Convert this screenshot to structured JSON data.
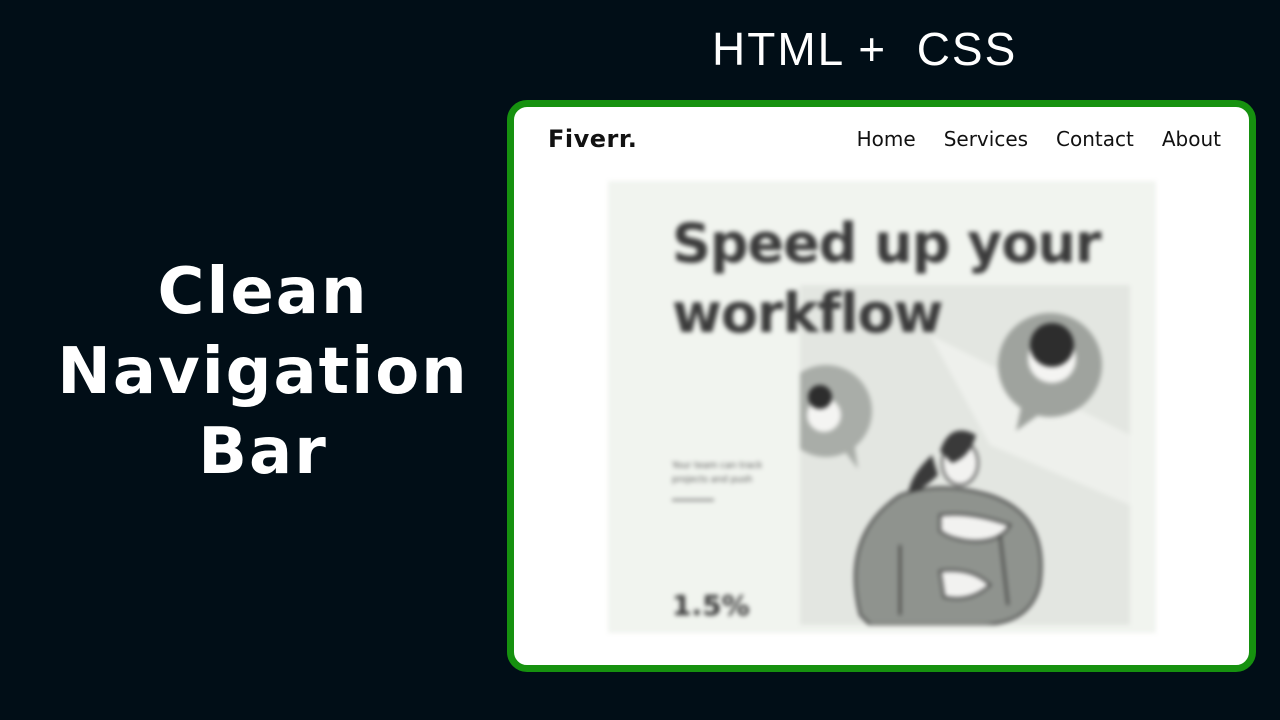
{
  "header": {
    "tech_label": "HTML +  CSS"
  },
  "title": {
    "lines": [
      "Clean",
      "Navigation",
      "Bar"
    ]
  },
  "preview": {
    "border_color": "#16910f",
    "navbar": {
      "logo": "Fiverr.",
      "links": [
        "Home",
        "Services",
        "Contact",
        "About"
      ]
    },
    "hero": {
      "heading_lines": [
        "Speed up your",
        "workflow"
      ],
      "body_lines": [
        "Your team can track",
        "projects and push"
      ],
      "stat": "1.5%"
    }
  }
}
